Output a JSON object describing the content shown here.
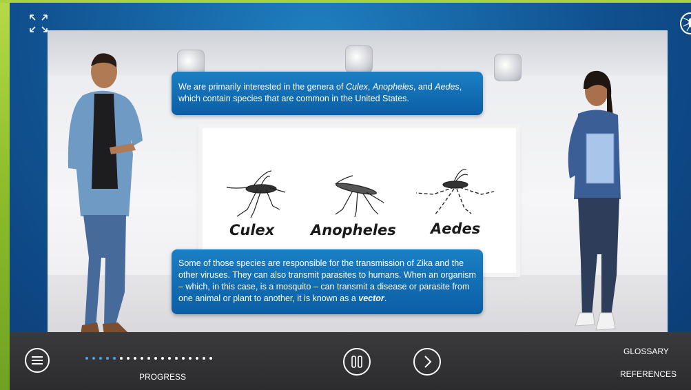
{
  "speech_top": {
    "intro": "We are primarily interested in the genera of ",
    "g1": "Culex",
    "sep1": ", ",
    "g2": "Anopheles",
    "sep2": ", and ",
    "g3": "Aedes",
    "outro": ", which contain species that are common in the United States."
  },
  "speech_bottom": {
    "text": "Some of those species are responsible for the transmission of Zika and the other viruses. They can also transmit parasites to humans.  When an organism –  which, in this case, is a mosquito – can transmit a disease or parasite from one animal or plant to another, it is known as a ",
    "term": "vector",
    "end": "."
  },
  "mosquitoes": {
    "culex": "Culex",
    "anopheles": "Anopheles",
    "aedes": "Aedes"
  },
  "toolbar": {
    "progress_label": "PROGRESS",
    "glossary": "GLOSSARY",
    "references": "REFERENCES",
    "progress_done": 5,
    "progress_total": 19
  },
  "colors": {
    "bubble": "#0b5ea5",
    "progress_done": "#4aa3e8",
    "progress_todo": "#ffffff",
    "frame_blue": "#10508f",
    "border_green": "#8dbf2a"
  },
  "icons": {
    "expand": "expand-icon",
    "logo": "mosquito-logo-icon",
    "menu": "hamburger-menu-icon",
    "pause": "pause-icon",
    "next": "chevron-right-icon"
  }
}
